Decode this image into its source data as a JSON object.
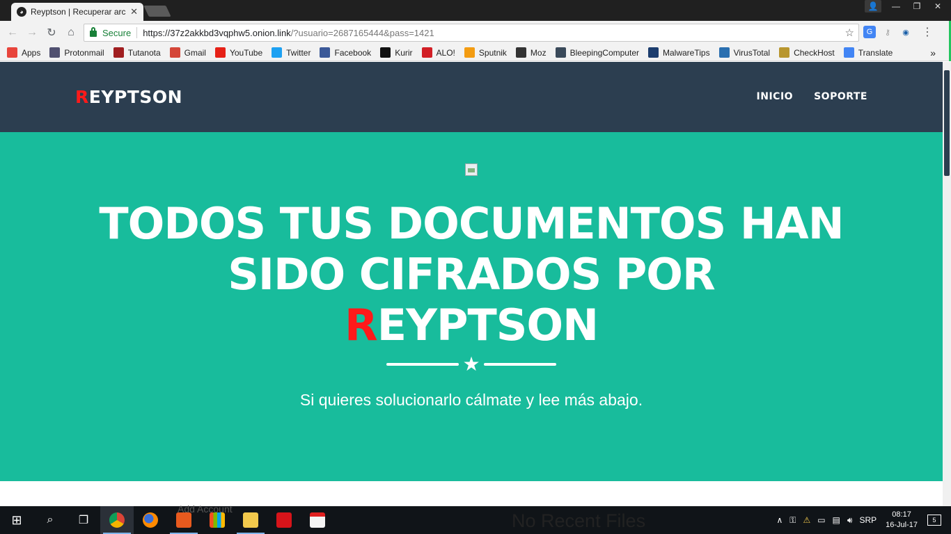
{
  "browser": {
    "tab_title": "Reyptson | Recuperar arc",
    "tab_close": "✕",
    "window_controls": {
      "minimize": "—",
      "restore": "❐",
      "close": "✕"
    },
    "secure_label": "Secure",
    "url_host": "https://37z2akkbd3vqphw5.onion.link",
    "url_rest": "/?usuario=2687165444&pass=1421",
    "bookmarks": [
      {
        "label": "Apps",
        "icon": "apps-grid-icon",
        "color": "#e8453c"
      },
      {
        "label": "Protonmail",
        "icon": "protonmail-icon",
        "color": "#505070"
      },
      {
        "label": "Tutanota",
        "icon": "tutanota-icon",
        "color": "#a01e20"
      },
      {
        "label": "Gmail",
        "icon": "gmail-icon",
        "color": "#d44638"
      },
      {
        "label": "YouTube",
        "icon": "youtube-icon",
        "color": "#e62117"
      },
      {
        "label": "Twitter",
        "icon": "twitter-icon",
        "color": "#1da1f2"
      },
      {
        "label": "Facebook",
        "icon": "facebook-icon",
        "color": "#3b5998"
      },
      {
        "label": "Kurir",
        "icon": "kurir-icon",
        "color": "#111111"
      },
      {
        "label": "ALO!",
        "icon": "alo-icon",
        "color": "#d21f26"
      },
      {
        "label": "Sputnik",
        "icon": "sputnik-icon",
        "color": "#f39c12"
      },
      {
        "label": "Moz",
        "icon": "moz-icon",
        "color": "#333333"
      },
      {
        "label": "BleepingComputer",
        "icon": "bleepingcomputer-icon",
        "color": "#3a4a5a"
      },
      {
        "label": "MalwareTips",
        "icon": "malwaretips-icon",
        "color": "#1c3d6e"
      },
      {
        "label": "VirusTotal",
        "icon": "virustotal-icon",
        "color": "#2a6fb0"
      },
      {
        "label": "CheckHost",
        "icon": "checkhost-icon",
        "color": "#b8962e"
      },
      {
        "label": "Translate",
        "icon": "translate-icon",
        "color": "#4285f4"
      }
    ]
  },
  "site": {
    "brand_first": "R",
    "brand_rest": "EYPTSON",
    "nav": [
      {
        "label": "INICIO"
      },
      {
        "label": "SOPORTE"
      }
    ],
    "headline_line1": "TODOS TUS DOCUMENTOS HAN",
    "headline_line2": "SIDO CIFRADOS POR",
    "headline_r": "R",
    "headline_rest": "EYPTSON",
    "subtitle": "Si quieres solucionarlo cálmate y lee más abajo.",
    "colors": {
      "nav_bg": "#2c3e50",
      "hero_bg": "#18bc9c",
      "accent": "#ff1a1a"
    }
  },
  "taskbar": {
    "ghost_text_1": "Add Account",
    "ghost_text_2": "No Recent Files",
    "language": "SRP",
    "time": "08:17",
    "date": "16-Jul-17",
    "notification_count": "5"
  }
}
